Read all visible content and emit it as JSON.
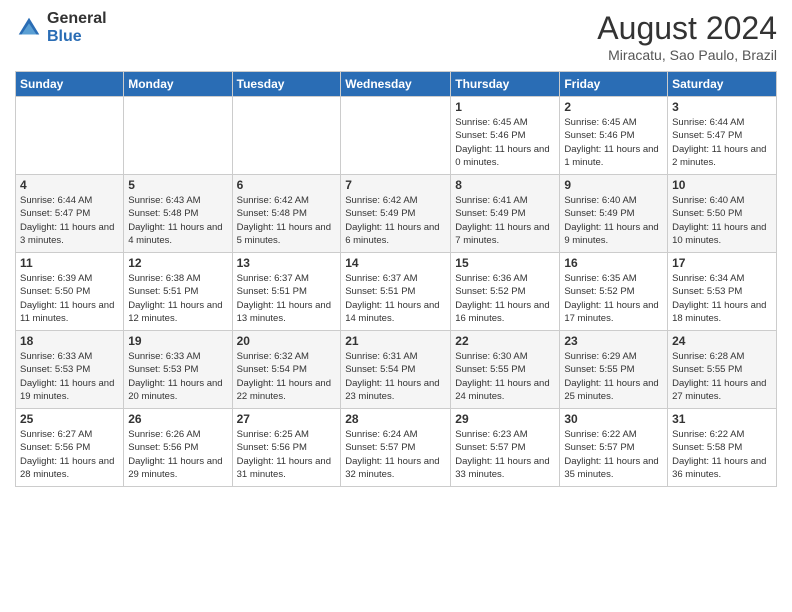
{
  "header": {
    "logo_general": "General",
    "logo_blue": "Blue",
    "month_title": "August 2024",
    "location": "Miracatu, Sao Paulo, Brazil"
  },
  "weekdays": [
    "Sunday",
    "Monday",
    "Tuesday",
    "Wednesday",
    "Thursday",
    "Friday",
    "Saturday"
  ],
  "weeks": [
    [
      {
        "day": "",
        "info": ""
      },
      {
        "day": "",
        "info": ""
      },
      {
        "day": "",
        "info": ""
      },
      {
        "day": "",
        "info": ""
      },
      {
        "day": "1",
        "info": "Sunrise: 6:45 AM\nSunset: 5:46 PM\nDaylight: 11 hours and 0 minutes."
      },
      {
        "day": "2",
        "info": "Sunrise: 6:45 AM\nSunset: 5:46 PM\nDaylight: 11 hours and 1 minute."
      },
      {
        "day": "3",
        "info": "Sunrise: 6:44 AM\nSunset: 5:47 PM\nDaylight: 11 hours and 2 minutes."
      }
    ],
    [
      {
        "day": "4",
        "info": "Sunrise: 6:44 AM\nSunset: 5:47 PM\nDaylight: 11 hours and 3 minutes."
      },
      {
        "day": "5",
        "info": "Sunrise: 6:43 AM\nSunset: 5:48 PM\nDaylight: 11 hours and 4 minutes."
      },
      {
        "day": "6",
        "info": "Sunrise: 6:42 AM\nSunset: 5:48 PM\nDaylight: 11 hours and 5 minutes."
      },
      {
        "day": "7",
        "info": "Sunrise: 6:42 AM\nSunset: 5:49 PM\nDaylight: 11 hours and 6 minutes."
      },
      {
        "day": "8",
        "info": "Sunrise: 6:41 AM\nSunset: 5:49 PM\nDaylight: 11 hours and 7 minutes."
      },
      {
        "day": "9",
        "info": "Sunrise: 6:40 AM\nSunset: 5:49 PM\nDaylight: 11 hours and 9 minutes."
      },
      {
        "day": "10",
        "info": "Sunrise: 6:40 AM\nSunset: 5:50 PM\nDaylight: 11 hours and 10 minutes."
      }
    ],
    [
      {
        "day": "11",
        "info": "Sunrise: 6:39 AM\nSunset: 5:50 PM\nDaylight: 11 hours and 11 minutes."
      },
      {
        "day": "12",
        "info": "Sunrise: 6:38 AM\nSunset: 5:51 PM\nDaylight: 11 hours and 12 minutes."
      },
      {
        "day": "13",
        "info": "Sunrise: 6:37 AM\nSunset: 5:51 PM\nDaylight: 11 hours and 13 minutes."
      },
      {
        "day": "14",
        "info": "Sunrise: 6:37 AM\nSunset: 5:51 PM\nDaylight: 11 hours and 14 minutes."
      },
      {
        "day": "15",
        "info": "Sunrise: 6:36 AM\nSunset: 5:52 PM\nDaylight: 11 hours and 16 minutes."
      },
      {
        "day": "16",
        "info": "Sunrise: 6:35 AM\nSunset: 5:52 PM\nDaylight: 11 hours and 17 minutes."
      },
      {
        "day": "17",
        "info": "Sunrise: 6:34 AM\nSunset: 5:53 PM\nDaylight: 11 hours and 18 minutes."
      }
    ],
    [
      {
        "day": "18",
        "info": "Sunrise: 6:33 AM\nSunset: 5:53 PM\nDaylight: 11 hours and 19 minutes."
      },
      {
        "day": "19",
        "info": "Sunrise: 6:33 AM\nSunset: 5:53 PM\nDaylight: 11 hours and 20 minutes."
      },
      {
        "day": "20",
        "info": "Sunrise: 6:32 AM\nSunset: 5:54 PM\nDaylight: 11 hours and 22 minutes."
      },
      {
        "day": "21",
        "info": "Sunrise: 6:31 AM\nSunset: 5:54 PM\nDaylight: 11 hours and 23 minutes."
      },
      {
        "day": "22",
        "info": "Sunrise: 6:30 AM\nSunset: 5:55 PM\nDaylight: 11 hours and 24 minutes."
      },
      {
        "day": "23",
        "info": "Sunrise: 6:29 AM\nSunset: 5:55 PM\nDaylight: 11 hours and 25 minutes."
      },
      {
        "day": "24",
        "info": "Sunrise: 6:28 AM\nSunset: 5:55 PM\nDaylight: 11 hours and 27 minutes."
      }
    ],
    [
      {
        "day": "25",
        "info": "Sunrise: 6:27 AM\nSunset: 5:56 PM\nDaylight: 11 hours and 28 minutes."
      },
      {
        "day": "26",
        "info": "Sunrise: 6:26 AM\nSunset: 5:56 PM\nDaylight: 11 hours and 29 minutes."
      },
      {
        "day": "27",
        "info": "Sunrise: 6:25 AM\nSunset: 5:56 PM\nDaylight: 11 hours and 31 minutes."
      },
      {
        "day": "28",
        "info": "Sunrise: 6:24 AM\nSunset: 5:57 PM\nDaylight: 11 hours and 32 minutes."
      },
      {
        "day": "29",
        "info": "Sunrise: 6:23 AM\nSunset: 5:57 PM\nDaylight: 11 hours and 33 minutes."
      },
      {
        "day": "30",
        "info": "Sunrise: 6:22 AM\nSunset: 5:57 PM\nDaylight: 11 hours and 35 minutes."
      },
      {
        "day": "31",
        "info": "Sunrise: 6:22 AM\nSunset: 5:58 PM\nDaylight: 11 hours and 36 minutes."
      }
    ]
  ]
}
